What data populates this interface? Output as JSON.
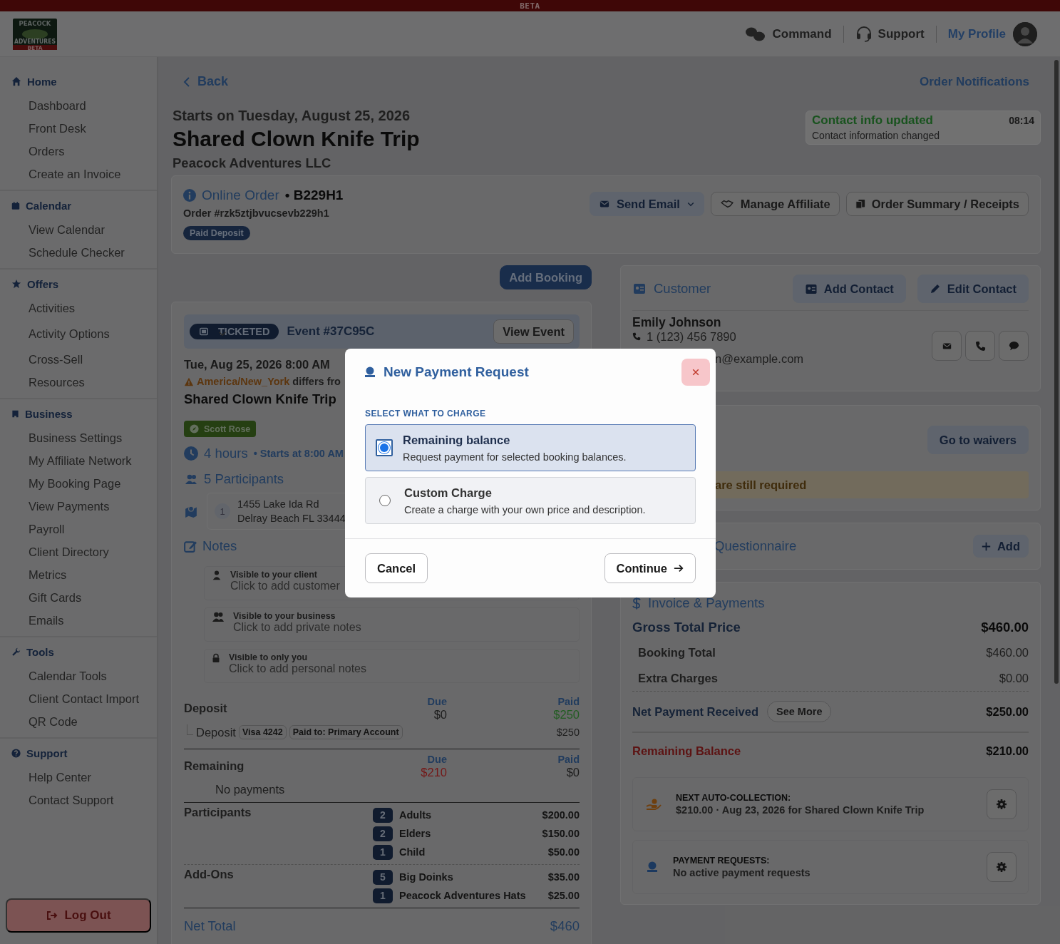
{
  "beta_banner": "BETA",
  "header": {
    "logo": {
      "top": "PEACOCK",
      "bottom": "ADVENTURES",
      "tag": "BETA"
    },
    "nav": [
      {
        "label": "Command"
      },
      {
        "label": "Support"
      }
    ],
    "profile": {
      "label": "My Profile"
    }
  },
  "sidebar": {
    "sections": [
      {
        "title": "Home",
        "items": [
          {
            "label": "Dashboard"
          },
          {
            "label": "Front Desk"
          },
          {
            "label": "Orders"
          },
          {
            "label": "Create an Invoice"
          }
        ]
      },
      {
        "title": "Calendar",
        "items": [
          {
            "label": "View Calendar"
          },
          {
            "label": "Schedule Checker"
          }
        ]
      },
      {
        "title": "Offers",
        "items": [
          {
            "label": "Activities",
            "kind": "link"
          },
          {
            "label": "Activity Options",
            "kind": "group"
          },
          {
            "label": "Cross-Sell",
            "kind": "link"
          },
          {
            "label": "Resources",
            "kind": "link"
          }
        ]
      },
      {
        "title": "Business",
        "items": [
          {
            "label": "Business Settings"
          },
          {
            "label": "My Affiliate Network"
          },
          {
            "label": "My Booking Page"
          },
          {
            "label": "View Payments"
          },
          {
            "label": "Payroll"
          },
          {
            "label": "Client Directory"
          },
          {
            "label": "Metrics"
          },
          {
            "label": "Gift Cards"
          },
          {
            "label": "Emails"
          }
        ]
      },
      {
        "title": "Tools",
        "items": [
          {
            "label": "Calendar Tools"
          },
          {
            "label": "Client Contact Import"
          },
          {
            "label": "QR Code"
          }
        ]
      },
      {
        "title": "Support",
        "items": [
          {
            "label": "Help Center"
          },
          {
            "label": "Contact Support"
          }
        ]
      }
    ],
    "logout": "Log Out"
  },
  "page": {
    "back": "Back",
    "order_notifications": "Order Notifications",
    "starts": "Starts on Tuesday, August 25, 2026",
    "title": "Shared Clown Knife Trip",
    "company": "Peacock Adventures LLC",
    "notification": {
      "title": "Contact info updated",
      "time": "08:14",
      "body": "Contact information changed"
    }
  },
  "order": {
    "source": "Online Order",
    "code": "• B229H1",
    "number": "Order #rzk5ztjbvucsevb229h1",
    "status": "Paid Deposit",
    "actions": [
      {
        "label": "Send Email",
        "kind": "dropdown"
      },
      {
        "label": "Manage Affiliate",
        "kind": "affiliate"
      },
      {
        "label": "Order Summary / Receipts",
        "kind": "receipts"
      }
    ]
  },
  "booking": {
    "add_booking": "Add Booking",
    "type": "TICKETED",
    "event": "Event #37C95C",
    "view_event": "View Event",
    "datetime": "Tue, Aug 25, 2026 8:00 AM",
    "timezone": "America/New_York",
    "timezone_note": "differs fro",
    "title": "Shared Clown Knife Trip",
    "guide": "Scott Rose",
    "duration": "4 hours",
    "start": "• Starts at 8:00 AM",
    "participants": "5 Participants",
    "location": {
      "index": "1",
      "line1": "1455 Lake Ida Rd",
      "line2": "Delray Beach FL 33444"
    },
    "notes_title": "Notes",
    "notes": [
      {
        "audience": "Visible to your client",
        "prompt": "Click to add customer"
      },
      {
        "audience": "Visible to your business",
        "prompt": "Click to add private notes"
      },
      {
        "audience": "Visible to only you",
        "prompt": "Click to add personal notes"
      }
    ]
  },
  "payments": [
    {
      "label": "Deposit",
      "due_label": "Due",
      "due": "$0",
      "due_overdue": false,
      "paid_label": "Paid",
      "paid": "$250",
      "paid_received": true,
      "entry": {
        "label": "Deposit",
        "card": "Visa 4242",
        "account": "Paid to: Primary Account",
        "amount": "$250"
      }
    },
    {
      "label": "Remaining",
      "due_label": "Due",
      "due": "$210",
      "due_overdue": true,
      "paid_label": "Paid",
      "paid": "$0",
      "paid_received": false,
      "empty": "No payments"
    }
  ],
  "line_items": [
    {
      "group": "Participants",
      "items": [
        {
          "qty": "2",
          "name": "Adults",
          "price": "$200.00"
        },
        {
          "qty": "2",
          "name": "Elders",
          "price": "$150.00"
        },
        {
          "qty": "1",
          "name": "Child",
          "price": "$50.00"
        }
      ]
    },
    {
      "group": "Add-Ons",
      "items": [
        {
          "qty": "5",
          "name": "Big Doinks",
          "price": "$35.00"
        },
        {
          "qty": "1",
          "name": "Peacock Adventures Hats",
          "price": "$25.00"
        }
      ]
    }
  ],
  "net_total": {
    "label": "Net Total",
    "value": "$460"
  },
  "customer": {
    "title": "Customer",
    "add_contact": "Add Contact",
    "edit_contact": "Edit Contact",
    "name": "Emily Johnson",
    "phone": "1 (123) 456 7890",
    "email": "n@example.com"
  },
  "waivers": {
    "action": "Go to waivers",
    "warning": "are still required"
  },
  "questionnaire": {
    "title": "Questionnaire",
    "action": "Add"
  },
  "invoice": {
    "title": "Invoice & Payments",
    "gross_label": "Gross Total Price",
    "gross": "$460.00",
    "breakdown": [
      {
        "label": "Booking Total",
        "value": "$460.00"
      },
      {
        "label": "Extra Charges",
        "value": "$0.00"
      }
    ],
    "received_label": "Net Payment Received",
    "see_more": "See More",
    "received": "$250.00",
    "remaining_label": "Remaining Balance",
    "remaining": "$210.00",
    "panels": [
      {
        "kind": "auto",
        "title": "NEXT AUTO-COLLECTION:",
        "body": "$210.00 · Aug 23, 2026 for Shared Clown Knife Trip"
      },
      {
        "kind": "requests",
        "title": "PAYMENT REQUESTS:",
        "body": "No active payment requests"
      }
    ]
  },
  "modal": {
    "title": "New Payment Request",
    "section_label": "SELECT WHAT TO CHARGE",
    "options": [
      {
        "title": "Remaining balance",
        "description": "Request payment for selected booking balances.",
        "selected": true
      },
      {
        "title": "Custom Charge",
        "description": "Create a charge with your own price and description.",
        "selected": false
      }
    ],
    "cancel": "Cancel",
    "continue": "Continue"
  }
}
